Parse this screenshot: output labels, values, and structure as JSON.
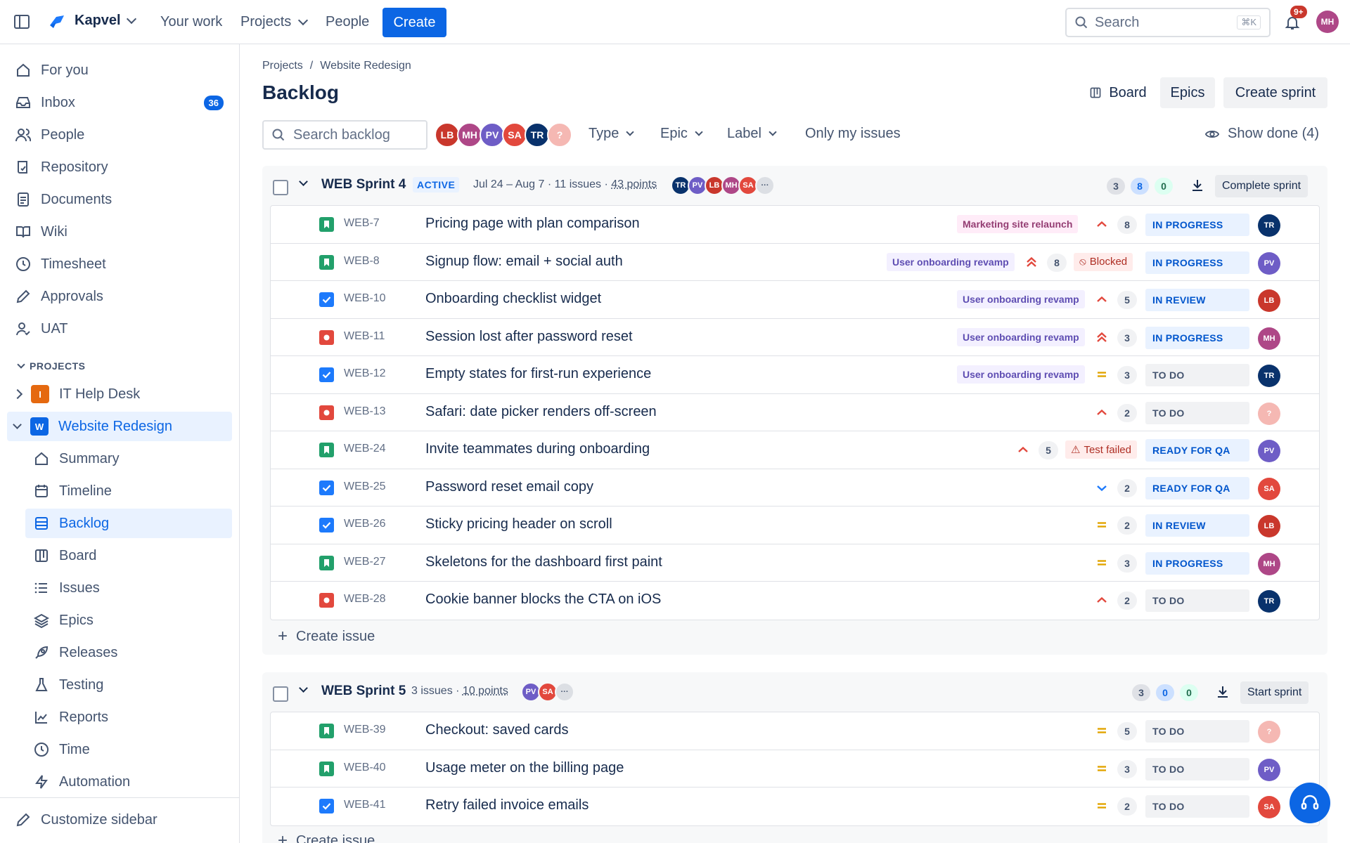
{
  "topnav": {
    "brand": "Kapvel",
    "your_work": "Your work",
    "projects": "Projects",
    "people": "People",
    "create": "Create",
    "search_placeholder": "Search",
    "search_shortcut": "⌘K",
    "notifications_badge": "9+",
    "user_initials": "MH"
  },
  "sidebar": {
    "items": [
      {
        "label": "For you",
        "icon": "home-icon"
      },
      {
        "label": "Inbox",
        "icon": "inbox-icon",
        "badge": "36"
      },
      {
        "label": "People",
        "icon": "people-icon"
      },
      {
        "label": "Repository",
        "icon": "repository-icon"
      },
      {
        "label": "Documents",
        "icon": "document-icon"
      },
      {
        "label": "Wiki",
        "icon": "book-icon"
      },
      {
        "label": "Timesheet",
        "icon": "clock-icon"
      },
      {
        "label": "Approvals",
        "icon": "pencil-icon"
      },
      {
        "label": "UAT",
        "icon": "user-check-icon"
      }
    ],
    "projects_heading": "PROJECTS",
    "projects": [
      {
        "label": "IT Help Desk",
        "letter": "I",
        "color": "#e56910"
      },
      {
        "label": "Website Redesign",
        "letter": "W",
        "color": "#0c66e4"
      }
    ],
    "project_items": [
      {
        "label": "Summary",
        "icon": "home-icon"
      },
      {
        "label": "Timeline",
        "icon": "calendar-icon"
      },
      {
        "label": "Backlog",
        "icon": "backlog-icon"
      },
      {
        "label": "Board",
        "icon": "board-icon"
      },
      {
        "label": "Issues",
        "icon": "list-icon"
      },
      {
        "label": "Epics",
        "icon": "layers-icon"
      },
      {
        "label": "Releases",
        "icon": "rocket-icon"
      },
      {
        "label": "Testing",
        "icon": "flask-icon"
      },
      {
        "label": "Reports",
        "icon": "chart-icon"
      },
      {
        "label": "Time",
        "icon": "clock-icon"
      },
      {
        "label": "Automation",
        "icon": "bolt-icon"
      }
    ],
    "customize": "Customize sidebar"
  },
  "main": {
    "breadcrumb": [
      "Projects",
      "/",
      "Website Redesign"
    ],
    "title": "Backlog",
    "board_btn": "Board",
    "epics_btn": "Epics",
    "create_sprint_btn": "Create sprint",
    "search_placeholder": "Search backlog",
    "avatars": [
      {
        "initials": "LB",
        "color": "#c9372c"
      },
      {
        "initials": "MH",
        "color": "#ae4787"
      },
      {
        "initials": "PV",
        "color": "#6e5dc6"
      },
      {
        "initials": "SA",
        "color": "#e2483d"
      },
      {
        "initials": "TR",
        "color": "#09326c"
      },
      {
        "initials": "?",
        "color": "#f5b8b3"
      }
    ],
    "filters": {
      "type": "Type",
      "epic": "Epic",
      "label": "Label",
      "only_mine": "Only my issues",
      "show_done": "Show done (4)"
    }
  },
  "sprint4": {
    "name": "WEB Sprint 4",
    "status": "ACTIVE",
    "meta_dates": "Jul 24 – Aug 7 · 11 issues · ",
    "meta_points": "43 points",
    "avatars": [
      "TR",
      "PV",
      "LB",
      "MH",
      "SA"
    ],
    "counts": {
      "todo": "3",
      "inprogress": "8",
      "done": "0"
    },
    "action": "Complete sprint",
    "create_issue": "Create issue",
    "issues": [
      {
        "type": "story",
        "key": "WEB-7",
        "summary": "Pricing page with plan comparison",
        "epic": "Marketing site relaunch",
        "priority": "high",
        "points": "8",
        "flag": "",
        "status": "IN PROGRESS",
        "assignee": "TR"
      },
      {
        "type": "story",
        "key": "WEB-8",
        "summary": "Signup flow: email + social auth",
        "epic": "User onboarding revamp",
        "priority": "highest",
        "points": "8",
        "flag": "Blocked",
        "status": "IN PROGRESS",
        "assignee": "PV"
      },
      {
        "type": "task",
        "key": "WEB-10",
        "summary": "Onboarding checklist widget",
        "epic": "User onboarding revamp",
        "priority": "high",
        "points": "5",
        "flag": "",
        "status": "IN REVIEW",
        "assignee": "LB"
      },
      {
        "type": "bug",
        "key": "WEB-11",
        "summary": "Session lost after password reset",
        "epic": "User onboarding revamp",
        "priority": "highest",
        "points": "3",
        "flag": "",
        "status": "IN PROGRESS",
        "assignee": "MH"
      },
      {
        "type": "task",
        "key": "WEB-12",
        "summary": "Empty states for first-run experience",
        "epic": "User onboarding revamp",
        "priority": "medium",
        "points": "3",
        "flag": "",
        "status": "TO DO",
        "assignee": "TR"
      },
      {
        "type": "bug",
        "key": "WEB-13",
        "summary": "Safari: date picker renders off-screen",
        "epic": "",
        "priority": "high",
        "points": "2",
        "flag": "",
        "status": "TO DO",
        "assignee": "?"
      },
      {
        "type": "story",
        "key": "WEB-24",
        "summary": "Invite teammates during onboarding",
        "epic": "",
        "priority": "high",
        "points": "5",
        "flag": "Test failed",
        "status": "READY FOR QA",
        "assignee": "PV"
      },
      {
        "type": "task",
        "key": "WEB-25",
        "summary": "Password reset email copy",
        "epic": "",
        "priority": "low",
        "points": "2",
        "flag": "",
        "status": "READY FOR QA",
        "assignee": "SA"
      },
      {
        "type": "task",
        "key": "WEB-26",
        "summary": "Sticky pricing header on scroll",
        "epic": "",
        "priority": "medium",
        "points": "2",
        "flag": "",
        "status": "IN REVIEW",
        "assignee": "LB"
      },
      {
        "type": "story",
        "key": "WEB-27",
        "summary": "Skeletons for the dashboard first paint",
        "epic": "",
        "priority": "medium",
        "points": "3",
        "flag": "",
        "status": "IN PROGRESS",
        "assignee": "MH"
      },
      {
        "type": "bug",
        "key": "WEB-28",
        "summary": "Cookie banner blocks the CTA on iOS",
        "epic": "",
        "priority": "high",
        "points": "2",
        "flag": "",
        "status": "TO DO",
        "assignee": "TR"
      }
    ]
  },
  "sprint5": {
    "name": "WEB Sprint 5",
    "meta_dates": "3 issues · ",
    "meta_points": "10 points",
    "avatars": [
      "PV",
      "SA"
    ],
    "counts": {
      "todo": "3",
      "inprogress": "0",
      "done": "0"
    },
    "action": "Start sprint",
    "create_issue": "Create issue",
    "issues": [
      {
        "type": "story",
        "key": "WEB-39",
        "summary": "Checkout: saved cards",
        "epic": "",
        "priority": "medium",
        "points": "5",
        "flag": "",
        "status": "TO DO",
        "assignee": "?"
      },
      {
        "type": "story",
        "key": "WEB-40",
        "summary": "Usage meter on the billing page",
        "epic": "",
        "priority": "medium",
        "points": "3",
        "flag": "",
        "status": "TO DO",
        "assignee": "PV"
      },
      {
        "type": "task",
        "key": "WEB-41",
        "summary": "Retry failed invoice emails",
        "epic": "",
        "priority": "medium",
        "points": "2",
        "flag": "",
        "status": "TO DO",
        "assignee": "SA"
      }
    ]
  },
  "colors": {
    "brand": "#0c66e4",
    "story": "#22a06b",
    "task": "#1d7afc",
    "bug": "#e2483d",
    "avatar_TR": "#09326c",
    "avatar_PV": "#6e5dc6",
    "avatar_LB": "#c9372c",
    "avatar_MH": "#ae4787",
    "avatar_SA": "#e2483d",
    "avatar_unknown": "#f5b8b3",
    "priority_high": "#e2483d",
    "priority_medium": "#e2a400",
    "priority_low": "#1d7afc"
  }
}
